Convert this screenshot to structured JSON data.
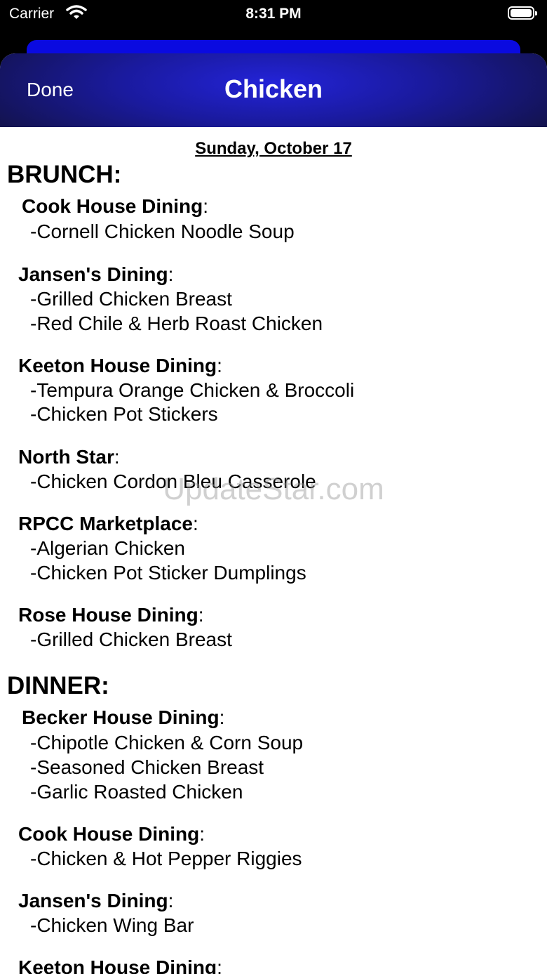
{
  "status_bar": {
    "carrier": "Carrier",
    "time": "8:31 PM"
  },
  "nav": {
    "done_label": "Done",
    "title": "Chicken"
  },
  "date": "Sunday, October 17",
  "meals": [
    {
      "label": "BRUNCH:",
      "halls": [
        {
          "name": "Cook House Dining",
          "items": [
            "-Cornell Chicken Noodle Soup"
          ]
        },
        {
          "name": "Jansen's Dining",
          "items": [
            "-Grilled Chicken Breast",
            "-Red Chile & Herb Roast Chicken"
          ]
        },
        {
          "name": "Keeton House Dining",
          "items": [
            "-Tempura Orange Chicken & Broccoli",
            "-Chicken Pot Stickers"
          ]
        },
        {
          "name": "North Star",
          "items": [
            "-Chicken Cordon Bleu Casserole"
          ]
        },
        {
          "name": "RPCC Marketplace",
          "items": [
            "-Algerian Chicken",
            "-Chicken Pot Sticker Dumplings"
          ]
        },
        {
          "name": "Rose House Dining",
          "items": [
            "-Grilled Chicken Breast"
          ]
        }
      ]
    },
    {
      "label": "DINNER:",
      "halls": [
        {
          "name": "Becker House Dining",
          "items": [
            "-Chipotle Chicken & Corn Soup",
            "-Seasoned Chicken Breast",
            "-Garlic Roasted Chicken"
          ]
        },
        {
          "name": "Cook House Dining",
          "items": [
            "-Chicken & Hot Pepper Riggies"
          ]
        },
        {
          "name": "Jansen's Dining",
          "items": [
            "-Chicken Wing Bar"
          ]
        },
        {
          "name": "Keeton House Dining",
          "items": []
        }
      ]
    }
  ],
  "watermark": "UpdateStar.com"
}
